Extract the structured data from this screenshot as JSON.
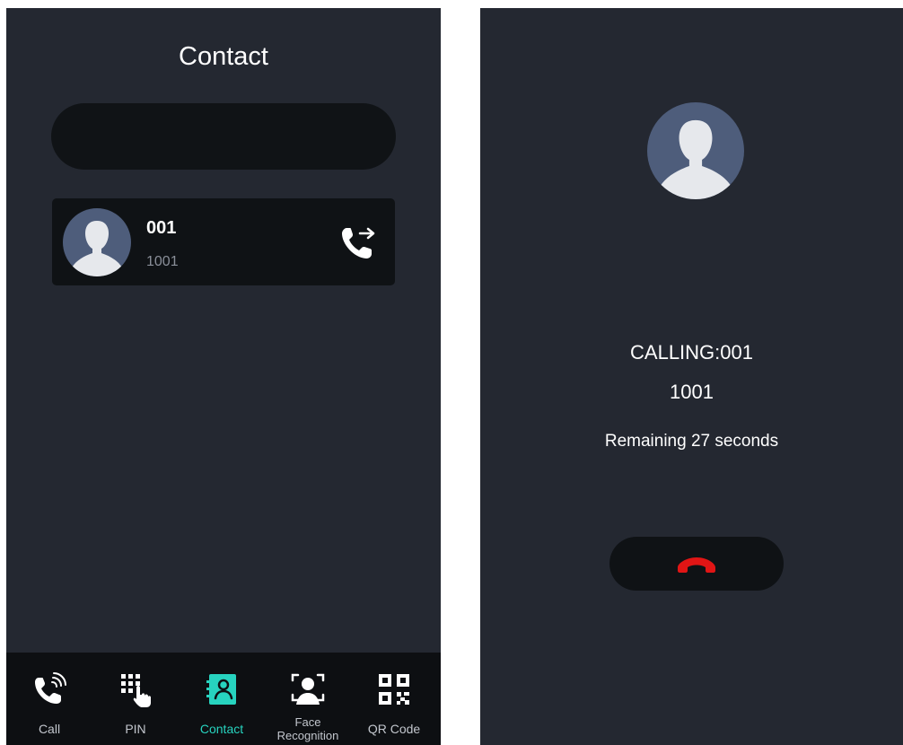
{
  "contact_screen": {
    "title": "Contact",
    "search": {
      "value": ""
    },
    "contacts": [
      {
        "name": "001",
        "number": "1001"
      }
    ],
    "tabs": [
      {
        "label": "Call",
        "icon": "call-icon",
        "active": false
      },
      {
        "label": "PIN",
        "icon": "pin-keypad-icon",
        "active": false
      },
      {
        "label": "Contact",
        "icon": "contact-book-icon",
        "active": true
      },
      {
        "label": "Face Recognition",
        "line1": "Face",
        "line2": "Recognition",
        "icon": "face-recognition-icon",
        "active": false
      },
      {
        "label": "QR Code",
        "icon": "qr-code-icon",
        "active": false
      }
    ]
  },
  "calling_screen": {
    "calling_label": "CALLING:001",
    "number": "1001",
    "remaining": "Remaining 27 seconds",
    "hangup_icon": "hang-up-icon"
  },
  "colors": {
    "background": "#242831",
    "card": "#0f1215",
    "tabbar": "#0d0f12",
    "accent": "#27d3bf",
    "avatar": "#4e5d7b",
    "hangup": "#e01515"
  }
}
